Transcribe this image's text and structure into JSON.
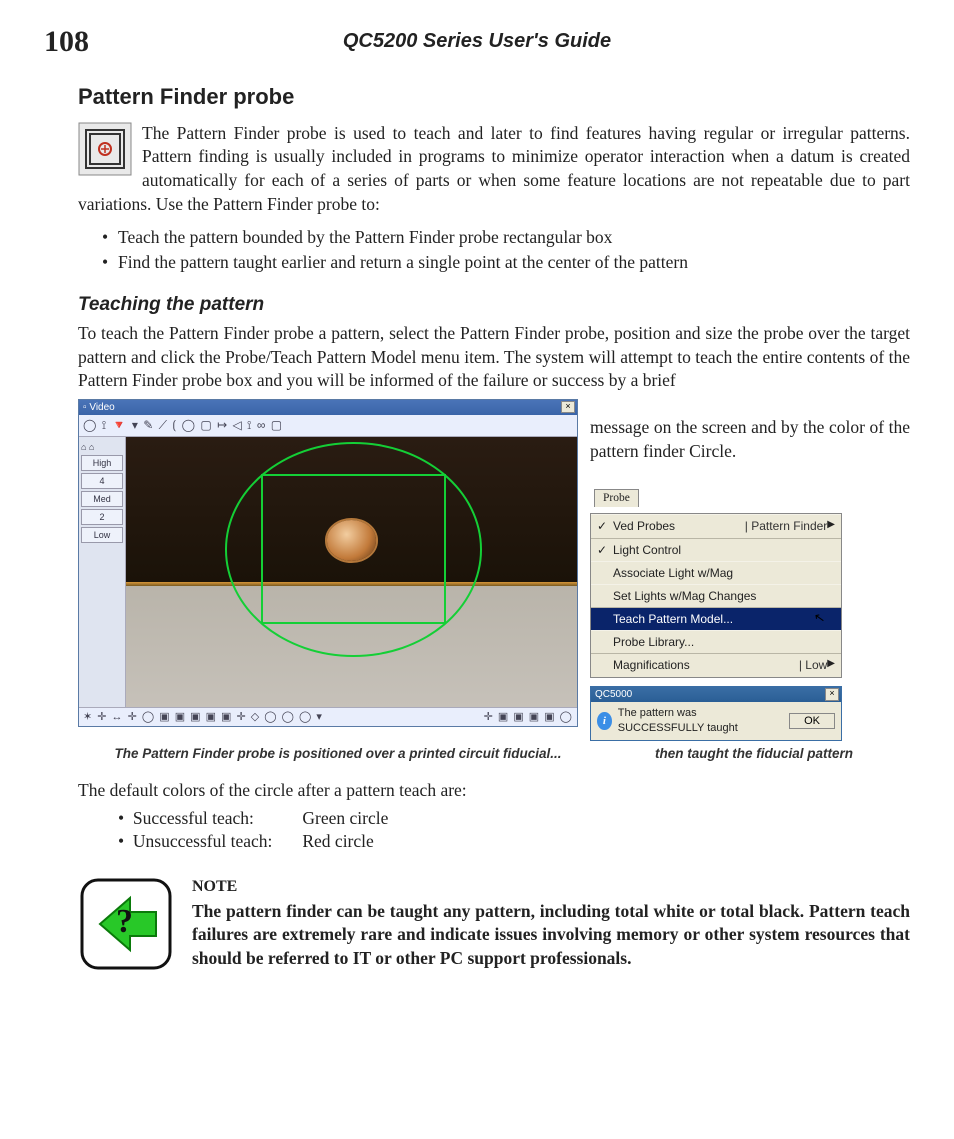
{
  "header": {
    "page_number": "108",
    "doc_title": "QC5200 Series User's Guide"
  },
  "section": {
    "title": "Pattern Finder probe",
    "intro": "The Pattern Finder probe is used to teach and later to find features having regular or irregular patterns.   Pattern finding is usually included in programs to minimize operator interaction when a datum is created automatically for each of a series of parts or when some feature locations are not repeatable due to part variations.  Use the Pattern Finder probe to:",
    "bullets": [
      "Teach the pattern bounded by the Pattern Finder probe rectangular box",
      "Find the pattern taught earlier and return a single point at the center of the pattern"
    ]
  },
  "teaching": {
    "title": "Teaching the pattern",
    "para1": "To teach the Pattern Finder probe a pattern, select the Pattern Finder probe, position and size the probe over the target pattern and click the Probe/Teach Pattern Model menu item.  The system will attempt to teach the entire contents of the Pattern Finder probe box and you will be informed of the failure or success by a brief",
    "rt_text": "message on the screen and by the color of the pattern finder Circle.",
    "caption_left": "The Pattern Finder probe is positioned over a printed circuit fiducial...",
    "caption_right": "then taught the fiducial pattern"
  },
  "video": {
    "title": "Video",
    "top_toolbar": "◯ ⟟ 🔻 ▾ ✎ ⟋ ⟮ ◯ ▢ ↦ ◁ ⟟ ∞ ▢",
    "side_top": "⌂ ⌂",
    "side_levels": [
      "High",
      "4",
      "Med",
      "2",
      "Low"
    ],
    "bottom_left": "✶ ✛ ↔ ✛ ◯ ▣ ▣ ▣ ▣ ▣ ✛ ◇ ◯ ◯ ◯ ▾",
    "bottom_right": "✛ ▣ ▣ ▣ ▣ ◯"
  },
  "menu": {
    "tab": "Probe",
    "items": [
      {
        "label": "Ved Probes",
        "checked": true,
        "right": "| Pattern Finder",
        "arrow": true
      },
      {
        "label": "Light Control",
        "checked": true,
        "sep": true
      },
      {
        "label": "Associate Light w/Mag"
      },
      {
        "label": "Set Lights w/Mag Changes"
      },
      {
        "label": "Teach Pattern Model...",
        "sel": true,
        "sep": true,
        "cursor": true
      },
      {
        "label": "Probe Library..."
      },
      {
        "label": "Magnifications",
        "right": "| Low",
        "arrow": true,
        "sep": true
      }
    ]
  },
  "dialog": {
    "title": "QC5000",
    "msg": "The pattern was SUCCESSFULLY taught",
    "ok": "OK"
  },
  "defaults": {
    "lead": "The default colors of the circle after a pattern teach are:",
    "rows": [
      {
        "b": "Successful teach:",
        "c": "Green circle"
      },
      {
        "b": "Unsuccessful teach:",
        "c": "Red circle"
      }
    ]
  },
  "note": {
    "label": "NOTE",
    "text": "The pattern finder can be taught any pattern, including total white or total black.  Pattern teach failures are extremely rare and indicate issues involving memory or other system resources that should be referred to IT or other PC support professionals."
  }
}
